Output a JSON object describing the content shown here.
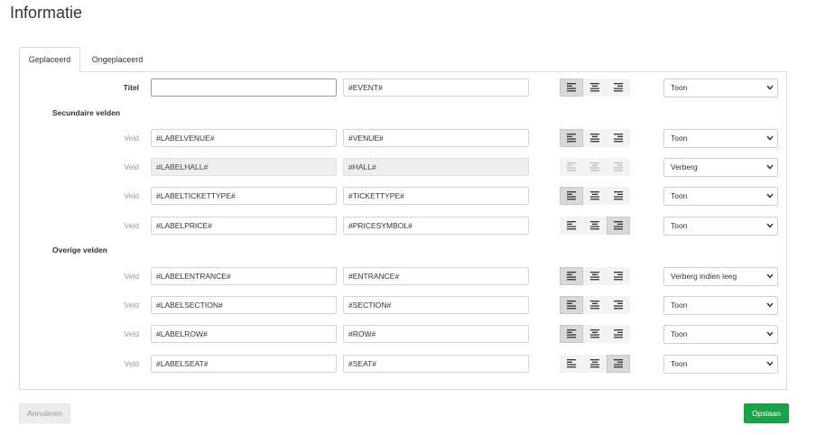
{
  "page_title": "Informatie",
  "tabs": [
    {
      "label": "Geplaceerd",
      "active": true
    },
    {
      "label": "Ongeplaceerd",
      "active": false
    }
  ],
  "title_row": {
    "label": "Titel",
    "field_a": {
      "value": ""
    },
    "field_b": {
      "value": "#EVENT#"
    },
    "align": "left",
    "visibility": "Toon"
  },
  "sections": [
    {
      "heading": "Secundaire velden",
      "rows": [
        {
          "label": "Veld",
          "field_a": "#LABELVENUE#",
          "field_b": "#VENUE#",
          "align": "left",
          "visibility": "Toon",
          "disabled": false
        },
        {
          "label": "Veld",
          "field_a": "#LABELHALL#",
          "field_b": "#HALL#",
          "align": "none",
          "visibility": "Verberg",
          "disabled": true
        },
        {
          "label": "Veld",
          "field_a": "#LABELTICKETTYPE#",
          "field_b": "#TICKETTYPE#",
          "align": "left",
          "visibility": "Toon",
          "disabled": false
        },
        {
          "label": "Veld",
          "field_a": "#LABELPRICE#",
          "field_b": "#PRICESYMBOL#",
          "align": "right",
          "visibility": "Toon",
          "disabled": false
        }
      ]
    },
    {
      "heading": "Overige velden",
      "rows": [
        {
          "label": "Veld",
          "field_a": "#LABELENTRANCE#",
          "field_b": "#ENTRANCE#",
          "align": "left",
          "visibility": "Verberg indien leeg",
          "disabled": false
        },
        {
          "label": "Veld",
          "field_a": "#LABELSECTION#",
          "field_b": "#SECTION#",
          "align": "left",
          "visibility": "Toon",
          "disabled": false
        },
        {
          "label": "Veld",
          "field_a": "#LABELROW#",
          "field_b": "#ROW#",
          "align": "left",
          "visibility": "Toon",
          "disabled": false
        },
        {
          "label": "Veld",
          "field_a": "#LABELSEAT#",
          "field_b": "#SEAT#",
          "align": "right",
          "visibility": "Toon",
          "disabled": false
        }
      ]
    }
  ],
  "footer": {
    "cancel_label": "Annuleren",
    "save_label": "Opslaan"
  },
  "colors": {
    "save_button": "#1aa34a",
    "active_align": "#d9d9d9",
    "disabled_field": "#eeeeee"
  }
}
